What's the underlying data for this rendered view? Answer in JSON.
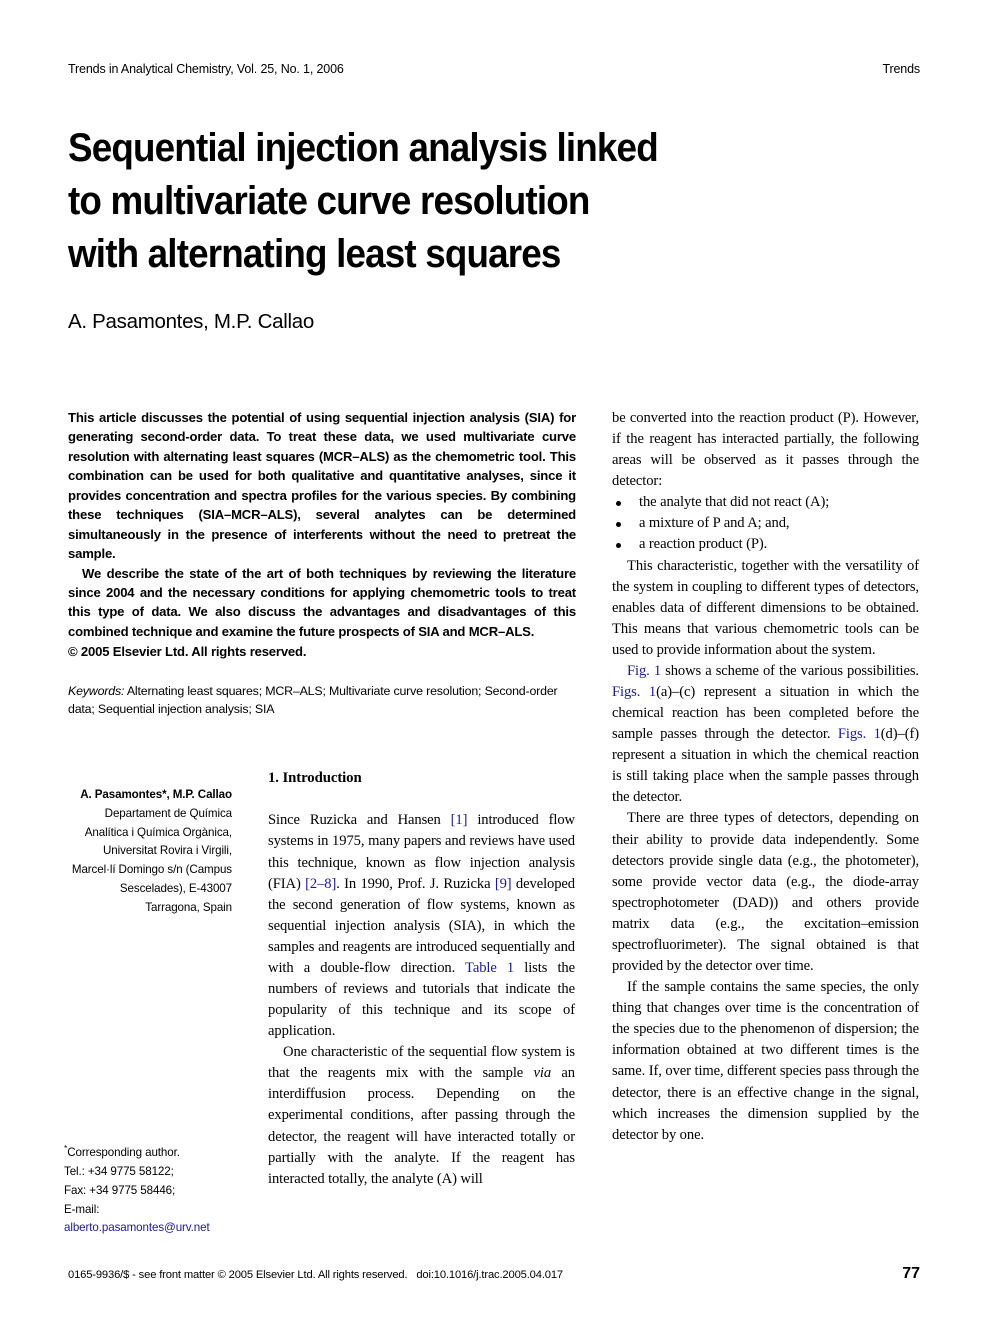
{
  "running_head": {
    "left": "Trends in Analytical Chemistry, Vol. 25, No. 1, 2006",
    "right": "Trends"
  },
  "title": {
    "line1": "Sequential injection analysis linked",
    "line2": "to multivariate curve resolution",
    "line3": "with alternating least squares",
    "full": "Sequential injection analysis linked to multivariate curve resolution with alternating least squares"
  },
  "authors": "A. Pasamontes, M.P. Callao",
  "abstract": {
    "para1": "This article discusses the potential of using sequential injection analysis (SIA) for generating second-order data. To treat these data, we used multivariate curve resolution with alternating least squares (MCR–ALS) as the chemometric tool. This combination can be used for both qualitative and quantitative analyses, since it provides concentration and spectra profiles for the various species. By combining these techniques (SIA–MCR–ALS), several analytes can be determined simultaneously in the presence of interferents without the need to pretreat the sample.",
    "para2": "We describe the state of the art of both techniques by reviewing the literature since 2004 and the necessary conditions for applying chemometric tools to treat this type of data. We also discuss the advantages and disadvantages of this combined technique and examine the future prospects of SIA and MCR–ALS.",
    "copyright": "© 2005 Elsevier Ltd. All rights reserved."
  },
  "keywords": {
    "label": "Keywords:",
    "text": " Alternating least squares; MCR–ALS; Multivariate curve resolution; Second-order data; Sequential injection analysis; SIA"
  },
  "affiliation": {
    "authors": "A. Pasamontes*, M.P. Callao",
    "line1": "Departament de Química",
    "line2": "Analítica i Química Orgànica,",
    "line3": "Universitat Rovira i Virgili,",
    "line4": "Marcel·lí Domingo s/n (Campus",
    "line5": "Sescelades), E-43007",
    "line6": "Tarragona, Spain"
  },
  "corresponding": {
    "heading": "Corresponding author.",
    "tel": "Tel.: +34 9775 58122;",
    "fax": "Fax: +34 9775 58446;",
    "email_label": "E-mail:",
    "email": "alberto.pasamontes@urv.net"
  },
  "sections": {
    "intro_heading": "1. Introduction"
  },
  "body": {
    "left": {
      "p1_a": "Since Ruzicka and Hansen ",
      "p1_ref1": "[1]",
      "p1_b": " introduced flow systems in 1975, many papers and reviews have used this technique, known as flow injection analysis (FIA) ",
      "p1_ref2": "[2–8]",
      "p1_c": ". In 1990, Prof. J. Ruzicka ",
      "p1_ref3": "[9]",
      "p1_d": " developed the second generation of flow systems, known as sequential injection analysis (SIA), in which the samples and reagents are introduced sequentially and with a double-flow direction. ",
      "p1_ref4": "Table 1",
      "p1_e": " lists the numbers of reviews and tutorials that indicate the popularity of this technique and its scope of application.",
      "p2_a": "One characteristic of the sequential flow system is that the reagents mix with the sample ",
      "p2_italic": "via",
      "p2_b": " an interdiffusion process. Depending on the experimental conditions, after passing through the detector, the reagent will have interacted totally or partially with the analyte. If the reagent has interacted totally, the analyte (A) will"
    },
    "right": {
      "p1": "be converted into the reaction product (P). However, if the reagent has interacted partially, the following areas will be observed as it passes through the detector:",
      "bullets": [
        "the analyte that did not react (A);",
        "a mixture of P and A; and,",
        "a reaction product (P)."
      ],
      "p2": "This characteristic, together with the versatility of the system in coupling to different types of detectors, enables data of different dimensions to be obtained. This means that various chemometric tools can be used to provide information about the system.",
      "p3_ref1": "Fig. 1",
      "p3_a": " shows a scheme of the various possibilities. ",
      "p3_ref2": "Figs. 1",
      "p3_b": "(a)–(c) represent a situation in which the chemical reaction has been completed before the sample passes through the detector. ",
      "p3_ref3": "Figs. 1",
      "p3_c": "(d)–(f) represent a situation in which the chemical reaction is still taking place when the sample passes through the detector.",
      "p4": "There are three types of detectors, depending on their ability to provide data independently. Some detectors provide single data (e.g., the photometer), some provide vector data (e.g., the diode-array spectrophotometer (DAD)) and others provide matrix data (e.g., the excitation–emission spectrofluorimeter). The signal obtained is that provided by the detector over time.",
      "p5": "If the sample contains the same species, the only thing that changes over time is the concentration of the species due to the phenomenon of dispersion; the information obtained at two different times is the same. If, over time, different species pass through the detector, there is an effective change in the signal, which increases the dimension supplied by the detector by one."
    }
  },
  "footer": {
    "issn_line": "0165-9936/$ - see front matter © 2005 Elsevier Ltd. All rights reserved.",
    "doi": "doi:10.1016/j.trac.2005.04.017",
    "page_number": "77"
  },
  "colors": {
    "link": "#1b1b8f",
    "text": "#000000",
    "background": "#ffffff"
  }
}
